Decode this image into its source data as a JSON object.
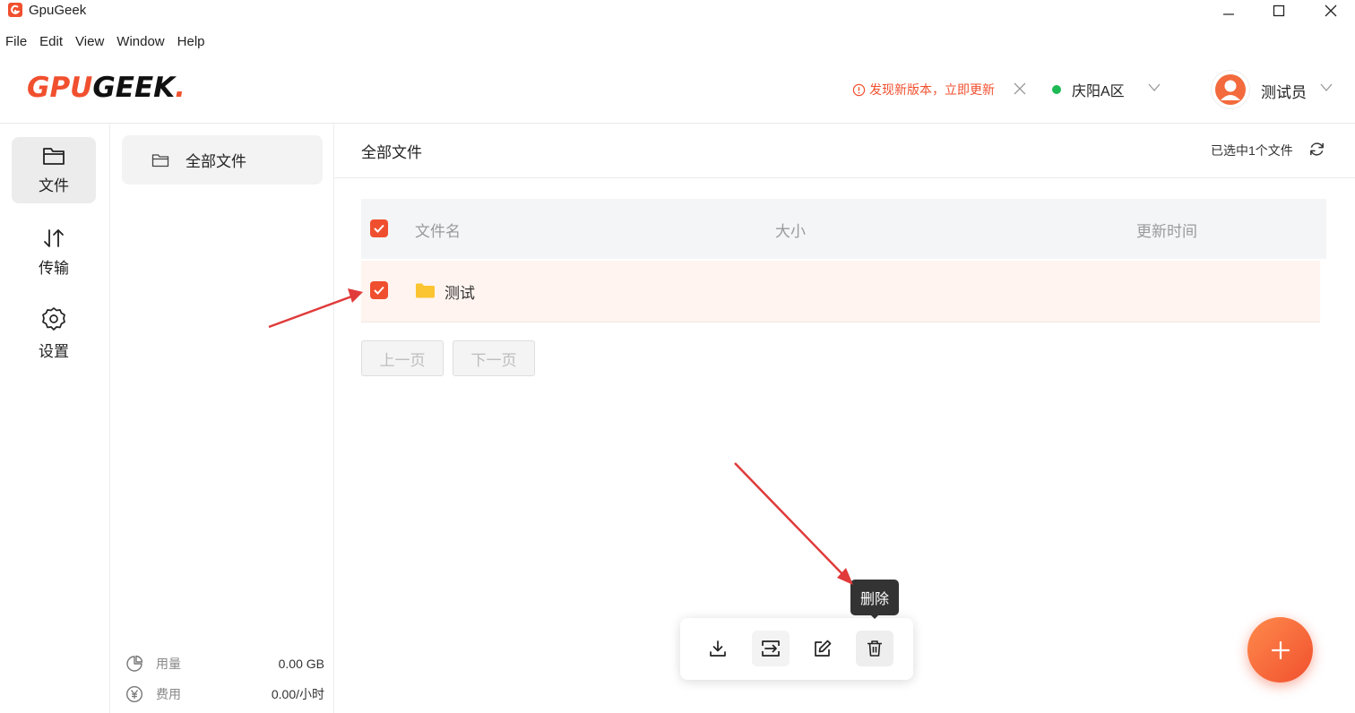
{
  "window": {
    "title": "GpuGeek"
  },
  "menu": [
    "File",
    "Edit",
    "View",
    "Window",
    "Help"
  ],
  "header": {
    "logo_gpu": "GPU",
    "logo_geek": "GEEK",
    "logo_dot": ".",
    "update_notice": "发现新版本，立即更新",
    "region": "庆阳A区",
    "user_name": "测试员"
  },
  "rail": {
    "files": "文件",
    "transfer": "传输",
    "settings": "设置"
  },
  "panel": {
    "folder_all": "全部文件",
    "usage_label": "用量",
    "usage_value": "0.00 GB",
    "cost_label": "费用",
    "cost_value": "0.00/小时"
  },
  "main": {
    "title": "全部文件",
    "selected_info": "已选中1个文件",
    "columns": {
      "name": "文件名",
      "size": "大小",
      "updated": "更新时间"
    },
    "rows": [
      {
        "name": "测试",
        "type": "folder",
        "checked": true
      }
    ],
    "prev_page": "上一页",
    "next_page": "下一页"
  },
  "toolbar": {
    "tooltip": "删除",
    "tools": [
      "download-icon",
      "move-icon",
      "edit-icon",
      "delete-icon"
    ]
  },
  "colors": {
    "accent": "#ef4f2e",
    "online": "#1db954"
  }
}
